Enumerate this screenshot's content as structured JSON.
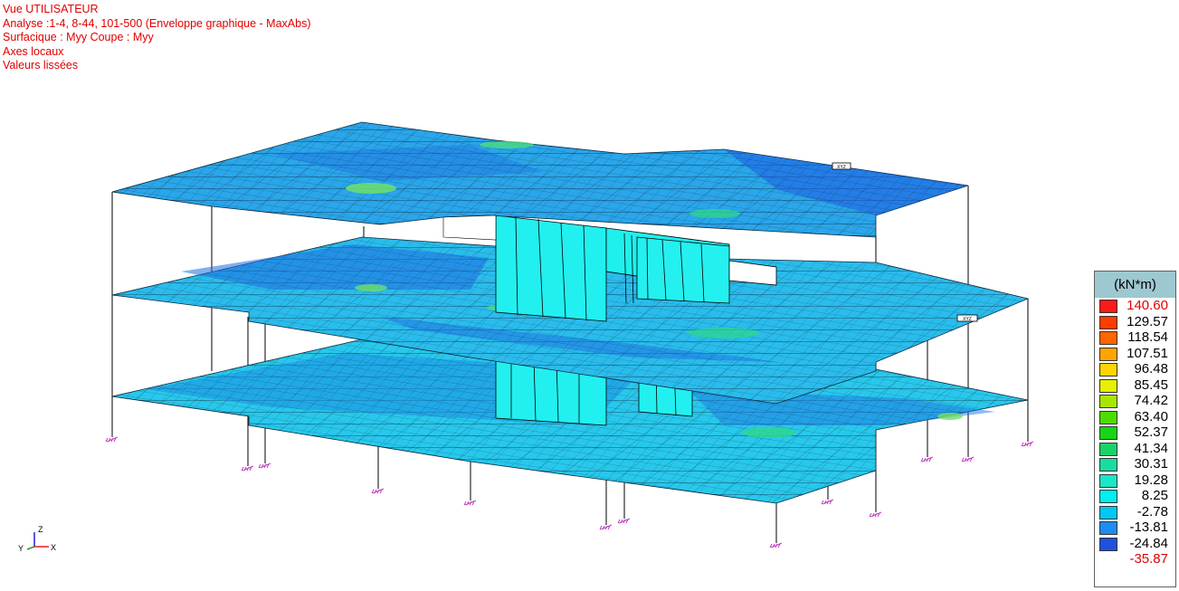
{
  "info": {
    "lines": [
      "Vue UTILISATEUR",
      "Analyse :1-4, 8-44, 101-500 (Enveloppe graphique - MaxAbs)",
      "Surfacique : Myy Coupe : Myy",
      "Axes locaux",
      "Valeurs lissées"
    ]
  },
  "legend": {
    "unit": "(kN*m)",
    "entries": [
      {
        "value": "140.60",
        "color": "#ff1a1a",
        "highlight": true
      },
      {
        "value": "129.57",
        "color": "#ff3d00"
      },
      {
        "value": "118.54",
        "color": "#ff6600"
      },
      {
        "value": "107.51",
        "color": "#ffa500"
      },
      {
        "value": "96.48",
        "color": "#ffd400"
      },
      {
        "value": "85.45",
        "color": "#e6f000"
      },
      {
        "value": "74.42",
        "color": "#a8e600"
      },
      {
        "value": "63.40",
        "color": "#4ddc00"
      },
      {
        "value": "52.37",
        "color": "#16d616"
      },
      {
        "value": "41.34",
        "color": "#1ad26a"
      },
      {
        "value": "30.31",
        "color": "#19dca0"
      },
      {
        "value": "19.28",
        "color": "#1ae6c8"
      },
      {
        "value": "8.25",
        "color": "#00f0f0"
      },
      {
        "value": "-2.78",
        "color": "#00c8f5"
      },
      {
        "value": "-13.81",
        "color": "#1e8cf0"
      },
      {
        "value": "-24.84",
        "color": "#2050e0"
      },
      {
        "value": "-35.87",
        "color": "#ffffff",
        "highlight": true
      }
    ],
    "text_color": "#000000",
    "highlight_color": "#e00000",
    "title_bg": "#9ec8cf"
  },
  "axes": {
    "z": "Z",
    "y": "Y",
    "x": "X"
  },
  "tags": [
    "XYZ",
    "XYZ"
  ],
  "colors": {
    "info_text": "#e00000",
    "slab_fill": "#1ea0e6",
    "slab_light": "#22e2ec",
    "core_fill": "#1ff0f0",
    "mesh": "#000000",
    "support": "#c040c0"
  }
}
